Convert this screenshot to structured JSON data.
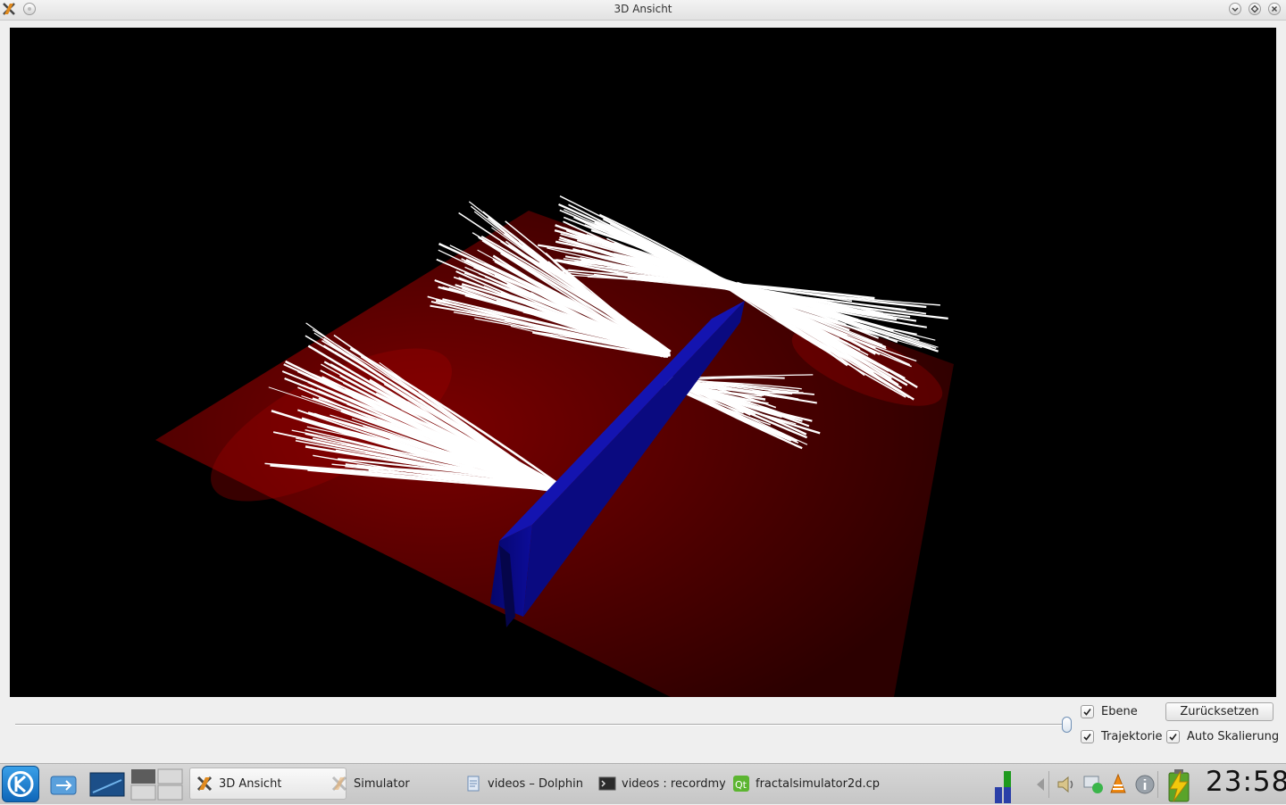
{
  "window": {
    "title": "3D Ansicht",
    "icons": {
      "app": "x-app-icon",
      "menu": "window-menu-icon",
      "minimize": "minimize-icon",
      "maximize": "maximize-icon",
      "close": "close-icon"
    }
  },
  "scene": {
    "background": "#000000",
    "plane_color": "#5a0000",
    "trajectory_color": "#ffffff",
    "barrier_color": "#0a0a8a"
  },
  "controls": {
    "slider_value": 0,
    "ebene": {
      "label": "Ebene",
      "checked": true
    },
    "trajektorie": {
      "label": "Trajektorie",
      "checked": true
    },
    "auto_skalierung": {
      "label": "Auto Skalierung",
      "checked": true
    },
    "reset_label": "Zurücksetzen"
  },
  "taskbar": {
    "tasks": [
      {
        "label": "3D Ansicht",
        "icon": "x-app-icon",
        "active": true
      },
      {
        "label": "Simulator",
        "icon": "x-app-icon",
        "active": false
      },
      {
        "label": "videos – Dolphin",
        "icon": "dolphin-icon",
        "active": false
      },
      {
        "label": "videos : recordmyde",
        "icon": "terminal-icon",
        "active": false
      },
      {
        "label": "fractalsimulator2d.cp",
        "icon": "qt-creator-icon",
        "active": false
      }
    ],
    "clock": "23:58"
  }
}
